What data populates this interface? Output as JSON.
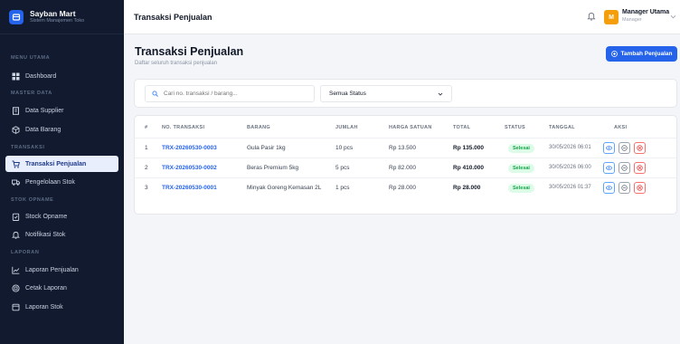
{
  "brand": {
    "name": "Sayban Mart",
    "subtitle": "Sistem Manajemen Toko"
  },
  "sidebar": {
    "sections": [
      {
        "label": "MENU UTAMA"
      },
      {
        "label": "MASTER DATA"
      },
      {
        "label": "TRANSAKSI"
      },
      {
        "label": "STOK OPNAME"
      },
      {
        "label": "LAPORAN"
      }
    ],
    "items": [
      {
        "label": "Dashboard",
        "icon": "grid-icon"
      },
      {
        "label": "Data Supplier",
        "icon": "building-icon"
      },
      {
        "label": "Data Barang",
        "icon": "box-icon"
      },
      {
        "label": "Transaksi Penjualan",
        "icon": "cart-icon"
      },
      {
        "label": "Pengelolaan Stok",
        "icon": "truck-icon"
      },
      {
        "label": "Stock Opname",
        "icon": "clipboard-icon"
      },
      {
        "label": "Notifikasi Stok",
        "icon": "bell-icon"
      },
      {
        "label": "Laporan Penjualan",
        "icon": "chart-line-icon"
      },
      {
        "label": "Cetak Laporan",
        "icon": "printer-icon"
      },
      {
        "label": "Laporan Stok",
        "icon": "file-icon"
      }
    ]
  },
  "topbar": {
    "title": "Transaksi Penjualan",
    "user": {
      "initial": "M",
      "name": "Manager Utama",
      "role": "Manager"
    }
  },
  "page": {
    "title": "Transaksi Penjualan",
    "subtitle": "Daftar seluruh transaksi penjualan",
    "add_button": "Tambah Penjualan"
  },
  "filters": {
    "search_placeholder": "Cari no. transaksi / barang...",
    "status_selected": "Semua Status"
  },
  "table": {
    "headers": [
      "#",
      "NO. TRANSAKSI",
      "BARANG",
      "JUMLAH",
      "HARGA SATUAN",
      "TOTAL",
      "STATUS",
      "TANGGAL",
      "AKSI"
    ],
    "rows": [
      {
        "no": "1",
        "trx": "TRX-20260530-0003",
        "item": "Gula Pasir 1kg",
        "qty": "10 pcs",
        "price": "Rp 13.500",
        "total": "Rp 135.000",
        "status": "Selesai",
        "date": "30/05/2026 06:01"
      },
      {
        "no": "2",
        "trx": "TRX-20260530-0002",
        "item": "Beras Premium 5kg",
        "qty": "5 pcs",
        "price": "Rp 82.000",
        "total": "Rp 410.000",
        "status": "Selesai",
        "date": "30/05/2026 06:00"
      },
      {
        "no": "3",
        "trx": "TRX-20260530-0001",
        "item": "Minyak Goreng Kemasan 2L",
        "qty": "1 pcs",
        "price": "Rp 28.000",
        "total": "Rp 28.000",
        "status": "Selesai",
        "date": "30/05/2026 01:37"
      }
    ]
  },
  "colors": {
    "sidebar_bg": "#111a2e",
    "accent": "#2563eb",
    "success": "#16a34a",
    "danger": "#ef4444"
  }
}
